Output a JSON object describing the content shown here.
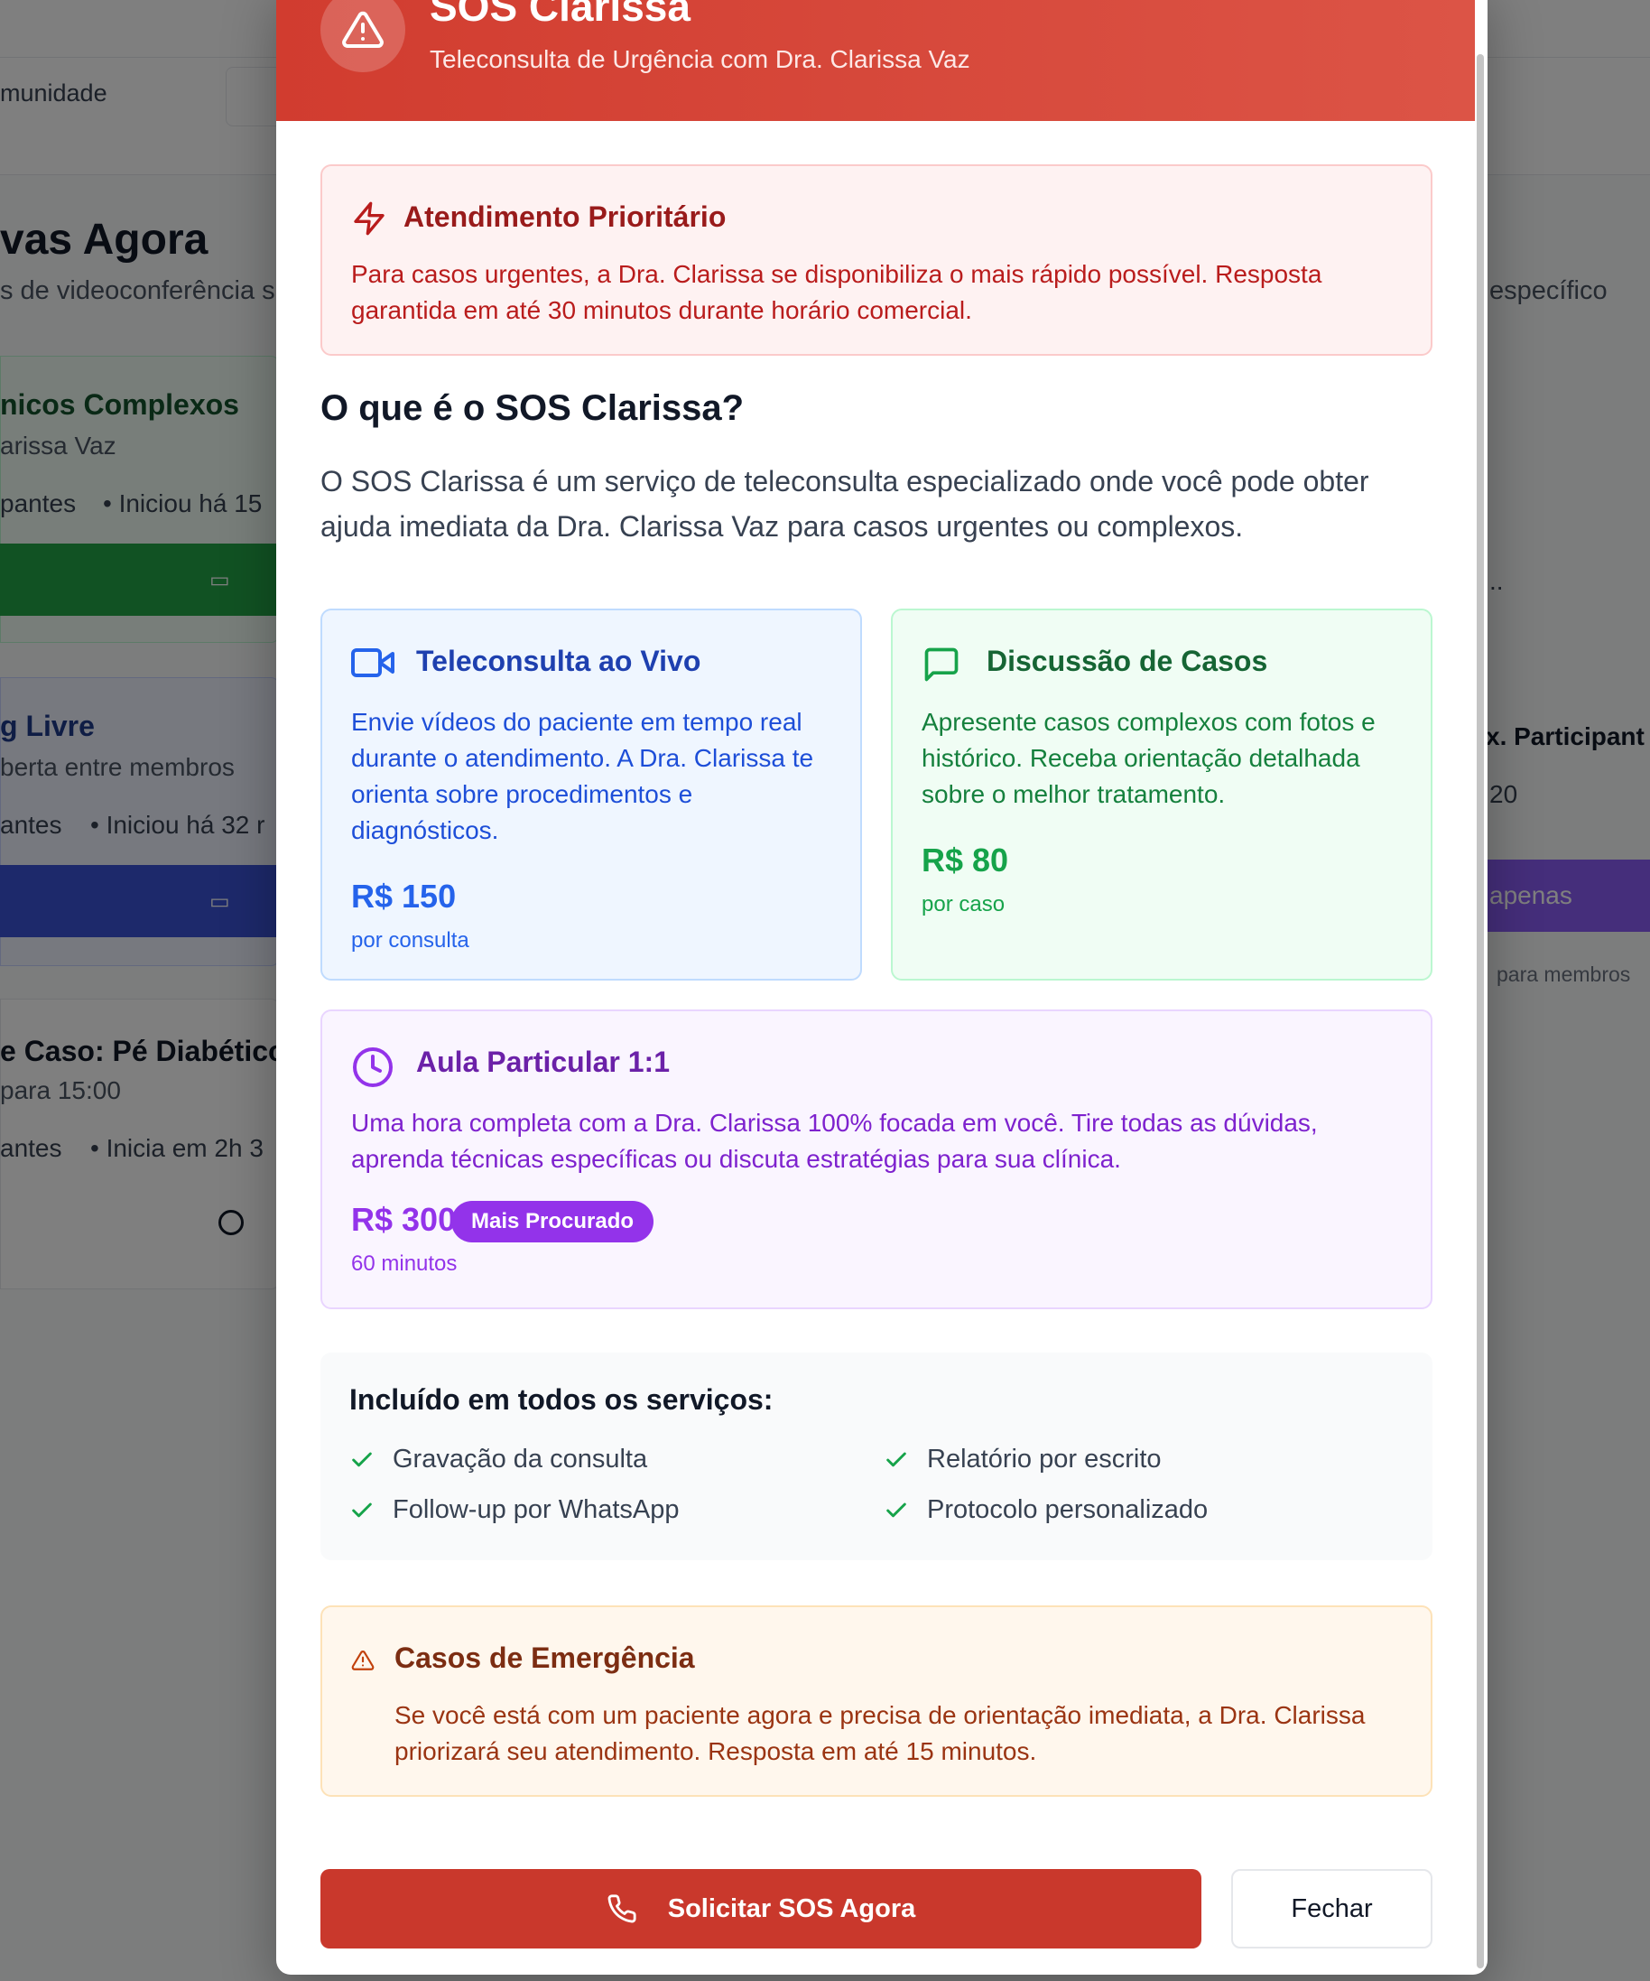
{
  "background": {
    "nav_fragment": "munidade",
    "heading_fragment": "vas Agora",
    "subtitle_fragment": "s de videoconferência s",
    "subtitle_right_fragment": "específico",
    "cards": [
      {
        "title": "nicos Complexos",
        "sub": "arissa Vaz",
        "meta_left": "pantes",
        "meta_right": "• Iniciou há 15"
      },
      {
        "title": "g Livre",
        "sub": "berta entre membros",
        "meta_left": "antes",
        "meta_right": "• Iniciou há 32 r"
      },
      {
        "title": "e Caso: Pé Diabético",
        "sub": "para 15:00",
        "meta_left": "antes",
        "meta_right": "• Inicia em 2h 3"
      }
    ],
    "right_panel": {
      "ellipsis": "..",
      "max_label": "x. Participant",
      "max_value": "20",
      "btn_label": "apenas",
      "note": "para membros"
    }
  },
  "modal": {
    "title": "SOS Clarissa",
    "subtitle": "Teleconsulta de Urgência com Dra. Clarissa Vaz",
    "priority": {
      "title": "Atendimento Prioritário",
      "text": "Para casos urgentes, a Dra. Clarissa se disponibiliza o mais rápido possível. Resposta garantida em até 30 minutos durante horário comercial."
    },
    "question": "O que é o SOS Clarissa?",
    "description": "O SOS Clarissa é um serviço de teleconsulta especializado onde você pode obter ajuda imediata da Dra. Clarissa Vaz para casos urgentes ou complexos.",
    "services": [
      {
        "title": "Teleconsulta ao Vivo",
        "text": "Envie vídeos do paciente em tempo real durante o atendimento. A Dra. Clarissa te orienta sobre procedimentos e diagnósticos.",
        "price": "R$ 150",
        "unit": "por consulta",
        "icon": "video-icon"
      },
      {
        "title": "Discussão de Casos",
        "text": "Apresente casos complexos com fotos e histórico. Receba orientação detalhada sobre o melhor tratamento.",
        "price": "R$ 80",
        "unit": "por caso",
        "icon": "chat-icon"
      },
      {
        "title": "Aula Particular 1:1",
        "text": "Uma hora completa com a Dra. Clarissa 100% focada em você. Tire todas as dúvidas, aprenda técnicas específicas ou discuta estratégias para sua clínica.",
        "price": "R$ 300",
        "unit": "60 minutos",
        "badge": "Mais Procurado",
        "icon": "clock-icon"
      }
    ],
    "included": {
      "title": "Incluído em todos os serviços:",
      "items": [
        "Gravação da consulta",
        "Relatório por escrito",
        "Follow-up por WhatsApp",
        "Protocolo personalizado"
      ]
    },
    "emergency": {
      "title": "Casos de Emergência",
      "text": "Se você está com um paciente agora e precisa de orientação imediata, a Dra. Clarissa priorizará seu atendimento. Resposta em até 15 minutos."
    },
    "buttons": {
      "primary": "Solicitar SOS Agora",
      "secondary": "Fechar"
    }
  },
  "colors": {
    "header": "#d13c2f",
    "primary_button": "#c9382c",
    "blue": "#1e40af",
    "green": "#166534",
    "purple": "#6b21a8"
  }
}
